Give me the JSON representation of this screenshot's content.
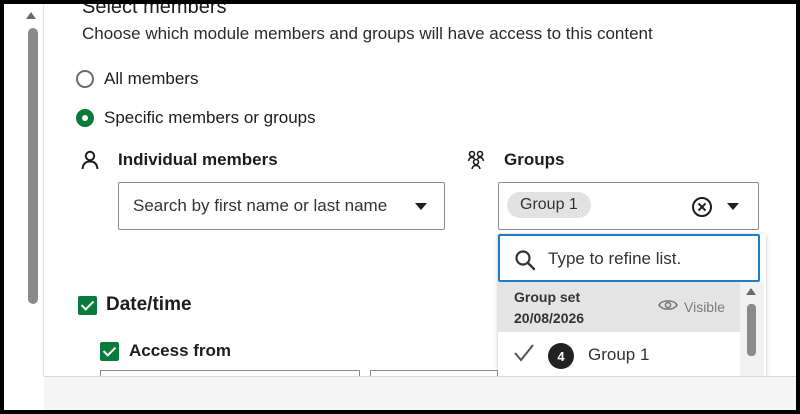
{
  "select_members": {
    "title": "Select members",
    "description": "Choose which module members and groups will have access to this content",
    "options": [
      {
        "label": "All members",
        "selected": false
      },
      {
        "label": "Specific members or groups",
        "selected": true
      }
    ]
  },
  "individual_members": {
    "label": "Individual members",
    "icon": "person-icon",
    "placeholder": "Search by first name or last name"
  },
  "groups": {
    "label": "Groups",
    "icon": "groups-icon",
    "selected_chip": "Group 1",
    "dropdown": {
      "search_placeholder": "Type to refine list.",
      "group_set": {
        "title": "Group set",
        "date": "20/08/2026",
        "visibility": "Visible"
      },
      "options": [
        {
          "label": "Group 1",
          "count": "4",
          "selected": true
        }
      ]
    }
  },
  "date_time": {
    "label": "Date/time",
    "checked": true,
    "access_from": {
      "label": "Access from",
      "checked": true
    }
  },
  "colors": {
    "accent_green": "#0a7a3b",
    "focus_blue": "#1e7dc8"
  }
}
